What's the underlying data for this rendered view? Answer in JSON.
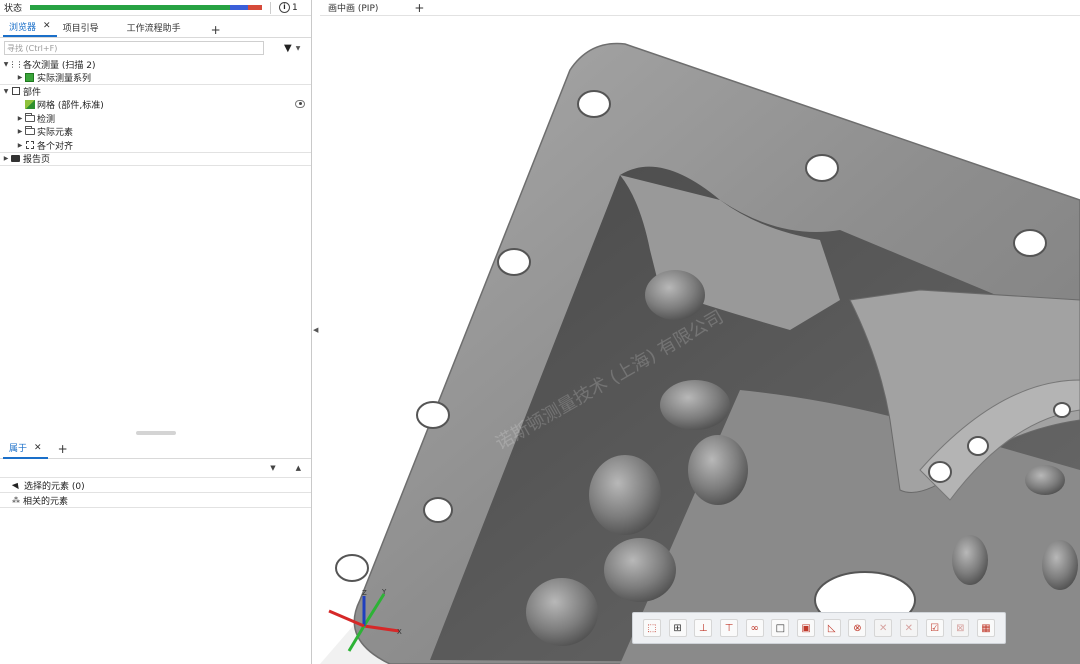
{
  "status_bar": {
    "label": "状态",
    "progress_colors": [
      "#27a243",
      "#3b5fd9",
      "#d64a3a"
    ],
    "info_count": "1"
  },
  "browser_tabs": [
    {
      "label": "浏览器",
      "active": true,
      "closable": true
    },
    {
      "label": "项目引导",
      "active": false
    },
    {
      "label": "工作流程助手",
      "active": false
    }
  ],
  "add_tab_label": "+",
  "search": {
    "placeholder": "寻找 (Ctrl+F)"
  },
  "tree": {
    "measurement_series": "各次测量 (扫描 2)",
    "actual_series": "实际测量系列",
    "parts": "部件",
    "mesh": "网格 (部件,标准)",
    "inspection": "检测",
    "actual_elements": "实际元素",
    "alignments": "各个对齐",
    "report_pages": "报告页"
  },
  "properties": {
    "tab_label": "属于",
    "selected_elements": "选择的元素 (0)",
    "related_elements": "相关的元素"
  },
  "viewport": {
    "tab_label": "画中画 (PIP)",
    "watermark": "诺斯顿测量技术 (上海) 有限公司",
    "toolbar_icons": [
      "select-region-icon",
      "fit-view-icon",
      "section-icon",
      "cut-plane-icon",
      "link-icon",
      "frame-icon",
      "box-icon",
      "triangle-icon",
      "chain-icon",
      "disabled-icon-1",
      "disabled-icon-2",
      "check-icon",
      "disabled-icon-3",
      "report-icon"
    ],
    "axis_labels": {
      "x": "X",
      "y": "Y",
      "z": "Z"
    }
  },
  "colors": {
    "accent_blue": "#1a6fc9",
    "part_gray": "#8c8c8c"
  }
}
